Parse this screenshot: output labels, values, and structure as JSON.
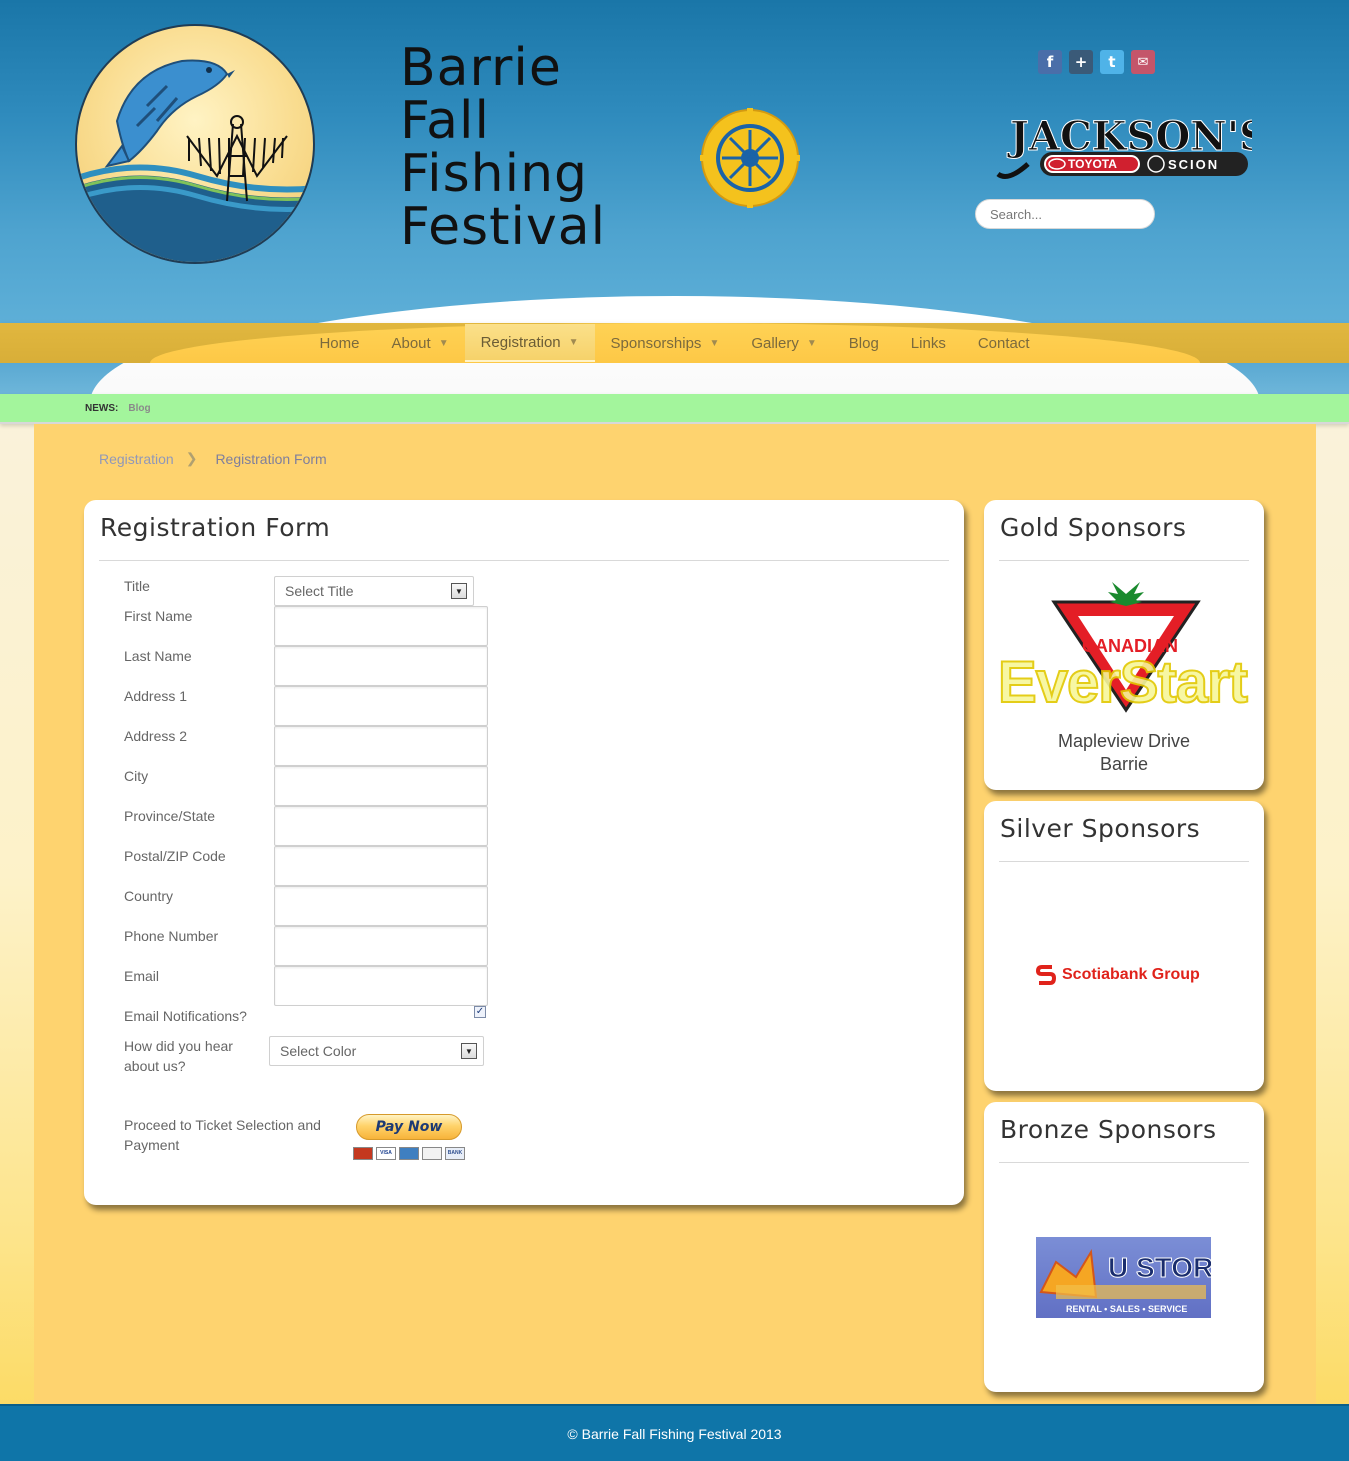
{
  "site": {
    "title_lines": [
      "Barrie",
      "Fall",
      "Fishing",
      "Festival"
    ],
    "search_placeholder": "Search..."
  },
  "social": {
    "facebook": "f",
    "googleplus": "+",
    "twitter": "t",
    "email": "✉"
  },
  "sponsor_header": {
    "brand": "JACKSON'S",
    "sub1": "TOYOTA",
    "sub2": "SCION"
  },
  "nav": {
    "items": [
      {
        "label": "Home",
        "dropdown": false
      },
      {
        "label": "About",
        "dropdown": true
      },
      {
        "label": "Registration",
        "dropdown": true,
        "active": true
      },
      {
        "label": "Sponsorships",
        "dropdown": true
      },
      {
        "label": "Gallery",
        "dropdown": true
      },
      {
        "label": "Blog",
        "dropdown": false
      },
      {
        "label": "Links",
        "dropdown": false
      },
      {
        "label": "Contact",
        "dropdown": false
      }
    ]
  },
  "news": {
    "label": "NEWS:",
    "link": "Blog"
  },
  "breadcrumb": {
    "parent": "Registration",
    "current": "Registration Form"
  },
  "form": {
    "heading": "Registration Form",
    "labels": {
      "title": "Title",
      "first_name": "First Name",
      "last_name": "Last Name",
      "address1": "Address 1",
      "address2": "Address 2",
      "city": "City",
      "province": "Province/State",
      "postal": "Postal/ZIP Code",
      "country": "Country",
      "phone": "Phone Number",
      "email": "Email",
      "notifications": "Email Notifications?",
      "heard_line1": "How did you hear",
      "heard_line2": "about us?",
      "proceed_line1": "Proceed to Ticket Selection and",
      "proceed_line2": "Payment"
    },
    "title_select": "Select Title",
    "heard_select": "Select Color",
    "notifications_checked": true,
    "pay_button": "Pay Now"
  },
  "sidebar": {
    "gold_title": "Gold Sponsors",
    "gold_caption_line1": "Mapleview Drive",
    "gold_caption_line2": "Barrie",
    "silver_title": "Silver Sponsors",
    "silver_sponsor": "Scotiabank Group",
    "bronze_title": "Bronze Sponsors",
    "bronze_sponsor": "U STOR",
    "bronze_tagline": "RENTAL • SALES • SERVICE"
  },
  "footer": {
    "text": "© Barrie Fall Fishing Festival 2013"
  }
}
